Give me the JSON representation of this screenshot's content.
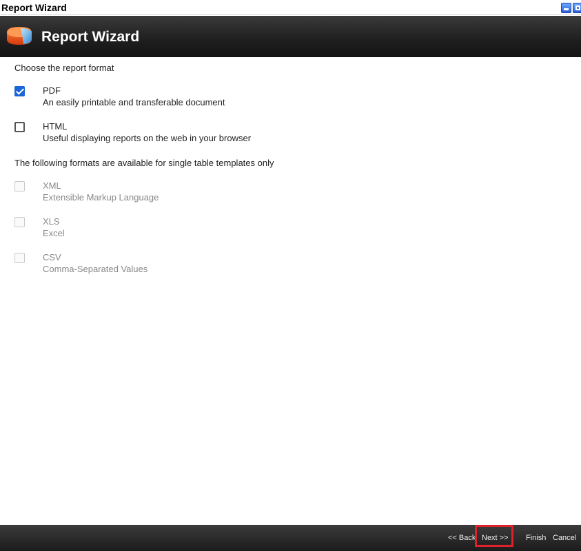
{
  "window": {
    "title": "Report Wizard",
    "icons": [
      "minimize-icon",
      "maximize-icon"
    ]
  },
  "header": {
    "title": "Report Wizard",
    "logo_icon": "report-logo-icon"
  },
  "sections": {
    "choose_label": "Choose the report format",
    "single_table_label": "The following formats are available for single table templates only"
  },
  "formats": [
    {
      "name": "PDF",
      "description": "An easily printable and transferable document",
      "checked": true,
      "enabled": true
    },
    {
      "name": "HTML",
      "description": "Useful displaying reports on the web in your browser",
      "checked": false,
      "enabled": true
    },
    {
      "name": "XML",
      "description": "Extensible Markup Language",
      "checked": false,
      "enabled": false
    },
    {
      "name": "XLS",
      "description": "Excel",
      "checked": false,
      "enabled": false
    },
    {
      "name": "CSV",
      "description": "Comma-Separated Values",
      "checked": false,
      "enabled": false
    }
  ],
  "footer": {
    "back_label": "<< Back",
    "next_label": "Next >>",
    "finish_label": "Finish",
    "cancel_label": "Cancel"
  },
  "colors": {
    "header_bg": "#1e1e1e",
    "checkbox_checked": "#1a66d6",
    "highlight": "#e0202a"
  }
}
